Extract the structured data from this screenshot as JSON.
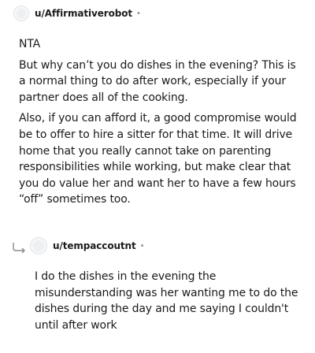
{
  "comment": {
    "username": "u/Affirmativerobot",
    "separator": "•",
    "paragraphs": [
      "NTA",
      "But why can’t you do dishes in the evening? This is a normal thing to do after work, especially if your partner does all of the cooking.",
      "Also, if you can afford it, a good compromise would be to offer to hire a sitter for that time. It will drive home that you really cannot take on parenting responsibilities while working, but make clear that you do value her and want her to have a few hours “off” sometimes too."
    ]
  },
  "reply": {
    "username": "u/tempaccoutnt",
    "separator": "•",
    "paragraphs": [
      "I do the dishes in the evening the misunderstanding was her wanting me to do the dishes during the day and me saying I couldn't until after work"
    ]
  },
  "icons": {
    "avatar": "avatar-icon",
    "reply_arrow": "reply-arrow-icon"
  }
}
